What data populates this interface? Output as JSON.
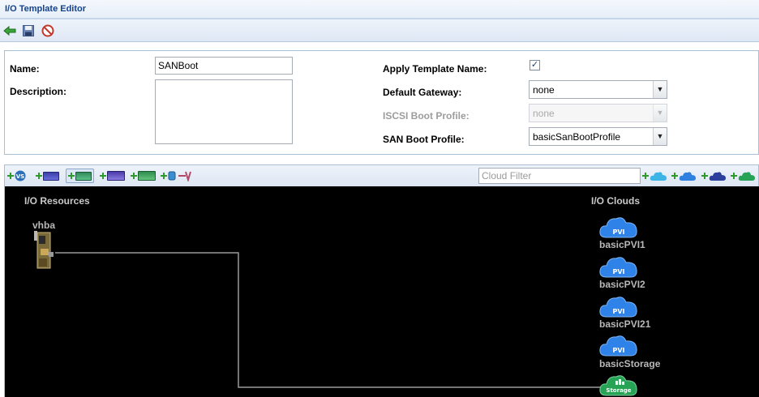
{
  "window": {
    "title": "I/O Template Editor"
  },
  "toolbar": {
    "back_icon": "green-back-arrow-icon",
    "save_icon": "floppy-disk-icon",
    "cancel_icon": "no-entry-icon"
  },
  "form": {
    "name": {
      "label": "Name:",
      "value": "SANBoot"
    },
    "description": {
      "label": "Description:",
      "value": ""
    },
    "apply_template_name": {
      "label": "Apply Template Name:",
      "checked": true
    },
    "default_gateway": {
      "label": "Default Gateway:",
      "value": "none"
    },
    "iscsi_boot_profile": {
      "label": "ISCSI Boot Profile:",
      "value": "none",
      "disabled": true
    },
    "san_boot_profile": {
      "label": "SAN Boot Profile:",
      "value": "basicSanBootProfile"
    }
  },
  "canvas_toolbar": {
    "buttons": [
      "add-vs-icon",
      "add-vnic-icon",
      "add-vhba-icon",
      "add-card-icon",
      "add-card-icon-2",
      "add-plug-icon",
      "connector-icon"
    ],
    "cloud_filter_placeholder": "Cloud Filter",
    "cloud_buttons": [
      "add-pvi-cloud-icon",
      "add-cloud-icon",
      "add-vlan-cloud-icon",
      "add-storage-cloud-icon"
    ]
  },
  "canvas": {
    "io_resources_heading": "I/O Resources",
    "io_clouds_heading": "I/O Clouds",
    "resources": [
      {
        "name": "vhba"
      }
    ],
    "clouds": [
      {
        "name": "basicPVI1",
        "badge": "PVI",
        "color": "#2f82e8"
      },
      {
        "name": "basicPVI2",
        "badge": "PVI",
        "color": "#2f82e8"
      },
      {
        "name": "basicPVI21",
        "badge": "PVI",
        "color": "#2f82e8"
      },
      {
        "name": "basicStorage",
        "badge": "PVI",
        "color": "#2f82e8"
      },
      {
        "name": "",
        "badge": "Storage",
        "color": "#27a356"
      }
    ]
  },
  "colors": {
    "accent": "#15428b",
    "canvas_bg": "#000000",
    "storage_green": "#27a356",
    "pvi_blue": "#2f82e8"
  }
}
